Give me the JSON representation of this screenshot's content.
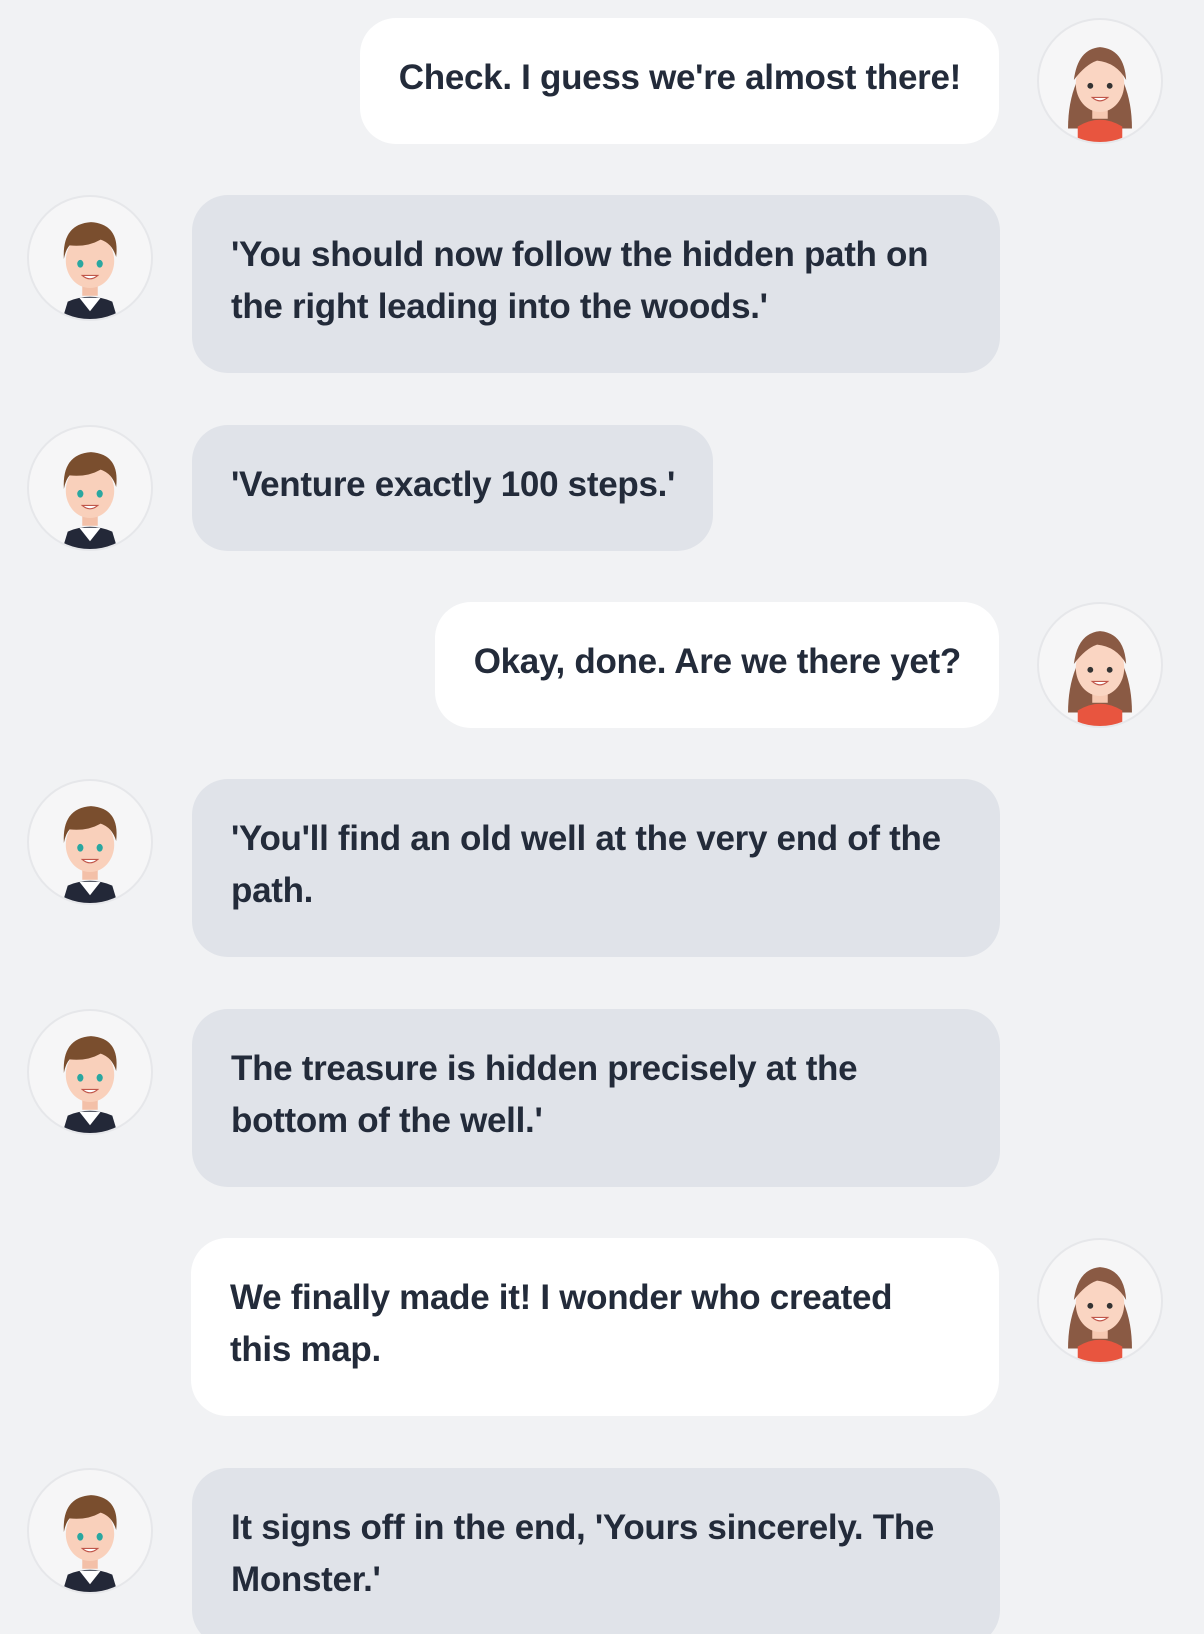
{
  "conversation": {
    "messages": [
      {
        "sender": "girl",
        "direction": "outgoing",
        "text": "Check. I guess we're almost there!"
      },
      {
        "sender": "boy",
        "direction": "incoming",
        "text": "'You should now follow the hidden path on the right leading into the woods.'"
      },
      {
        "sender": "boy",
        "direction": "incoming",
        "text": "'Venture exactly 100 steps.'"
      },
      {
        "sender": "girl",
        "direction": "outgoing",
        "text": "Okay, done. Are we there yet?"
      },
      {
        "sender": "boy",
        "direction": "incoming",
        "text": "'You'll find an old well at the very end of the path."
      },
      {
        "sender": "boy",
        "direction": "incoming",
        "text": "The treasure is hidden precisely at the bottom of the well.'"
      },
      {
        "sender": "girl",
        "direction": "outgoing",
        "text": "We finally made it! I wonder who created this map."
      },
      {
        "sender": "boy",
        "direction": "incoming",
        "text": "It signs off in the end, 'Yours sincerely. The Monster.'"
      }
    ]
  },
  "colors": {
    "background": "#f1f2f4",
    "incoming_bubble": "#e0e3e9",
    "outgoing_bubble": "#ffffff",
    "text": "#232b3a"
  },
  "icons": {
    "girl_avatar": "girl-avatar-icon",
    "boy_avatar": "boy-avatar-icon"
  }
}
